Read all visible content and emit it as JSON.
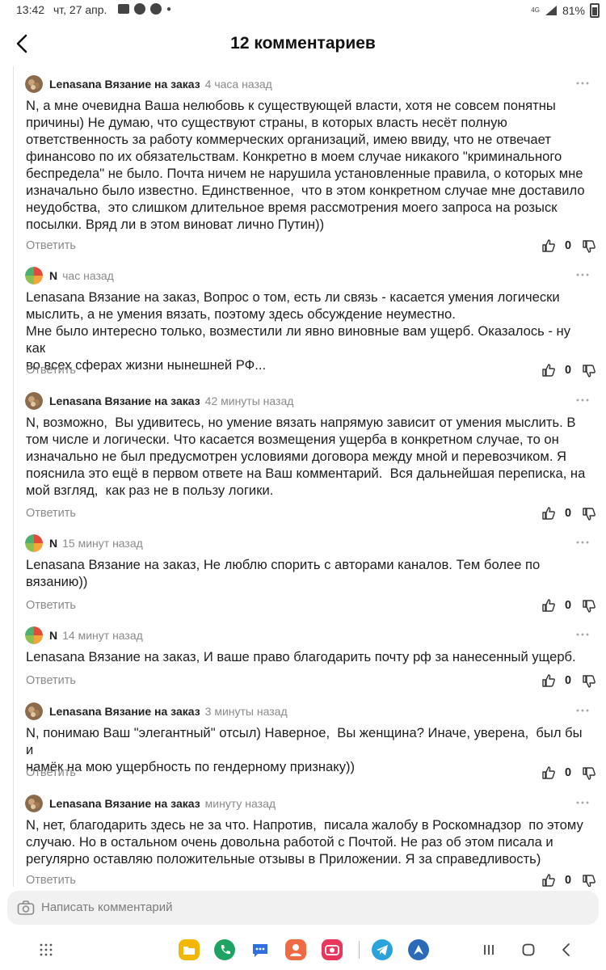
{
  "status": {
    "time": "13:42",
    "date": "чт, 27 апр.",
    "network": "4G",
    "battery": "81%"
  },
  "header": {
    "title": "12 комментариев"
  },
  "comments": [
    {
      "author": "Lenasana Вязание на заказ",
      "avatar": "yarn",
      "time": "4 часа назад",
      "text": "N, а мне очевидна Ваша нелюбовь к существующей власти, хотя не совсем понятны\nпричины) Не думаю, что существуют страны, в которых власть несёт полную\nответственность за работу коммерческих организаций, имею ввиду, что не отвечает\nфинансово по их обязательствам. Конкретно в моем случае никакого \"криминального\nбеспредела\" не было. Почта ничем не нарушила установленные правила, о которых мне\nизначально было известно. Единственное,  что в этом конкретном случае мне доставило\nнеудобства,  это слишком длительное время рассмотрения моего запроса на розыск\nпосылки. Вряд ли в этом виноват лично Путин))",
      "reply": "Ответить",
      "likes": "0"
    },
    {
      "author": "N",
      "avatar": "pie",
      "time": "час назад",
      "text": "Lenasana Вязание на заказ, Вопрос о том, есть ли связь - касается умения логически\nмыслить, а не умения вязать, поэтому здесь обсуждение неуместно.\nМне было интересно только, возместили ли явно виновные вам ущерб. Оказалось - ну как\nво всех сферах жизни нынешней РФ...",
      "reply": "Ответить",
      "likes": "0"
    },
    {
      "author": "Lenasana Вязание на заказ",
      "avatar": "yarn",
      "time": "42 минуты назад",
      "text": "N, возможно,  Вы удивитесь, но умение вязать напрямую зависит от умения мыслить. В\nтом числе и логически. Что касается возмещения ущерба в конкретном случае, то он\nизначально не был предусмотрен условиями договора между мной и перевозчиком. Я\nпояснила это ещё в первом ответе на Ваш комментарий.  Вся дальнейшая переписка, на\nмой взгляд,  как раз не в пользу логики.",
      "reply": "Ответить",
      "likes": "0"
    },
    {
      "author": "N",
      "avatar": "pie",
      "time": "15 минут назад",
      "text": "Lenasana Вязание на заказ, Не люблю спорить с авторами каналов. Тем более по\nвязанию))",
      "reply": "Ответить",
      "likes": "0"
    },
    {
      "author": "N",
      "avatar": "pie",
      "time": "14 минут назад",
      "text": "Lenasana Вязание на заказ, И ваше право благодарить почту рф за нанесенный ущерб.",
      "reply": "Ответить",
      "likes": "0"
    },
    {
      "author": "Lenasana Вязание на заказ",
      "avatar": "yarn",
      "time": "3 минуты назад",
      "text": "N, понимаю Ваш \"элегантный\" отсыл) Наверное,  Вы женщина? Иначе, уверена,  был бы  и\nнамёк на мою ущербность по гендерному признаку))",
      "reply": "Ответить",
      "likes": "0"
    },
    {
      "author": "Lenasana Вязание на заказ",
      "avatar": "yarn",
      "time": "минуту назад",
      "text": "N, нет, благодарить здесь не за что. Напротив,  писала жалобу в Роскомнадзор  по этому\nслучаю. Но в остальном очень довольна работой с Почтой. Не раз об этом писала и\nрегулярно оставляю положительные отзывы в Приложении. Я за справедливость)",
      "reply": "Ответить",
      "likes": "0"
    }
  ],
  "composer": {
    "placeholder": "Написать комментарий"
  },
  "navbar": {
    "apps": [
      "files",
      "phone",
      "messages",
      "contacts",
      "camera",
      "telegram",
      "browser"
    ],
    "colors": {
      "files": "#f2b705",
      "phone": "#1ea362",
      "messages": "#2f6fe0",
      "contacts": "#f06a44",
      "camera": "#e8365d",
      "telegram": "#2aa3dc",
      "browser": "#2a6ab8"
    }
  }
}
